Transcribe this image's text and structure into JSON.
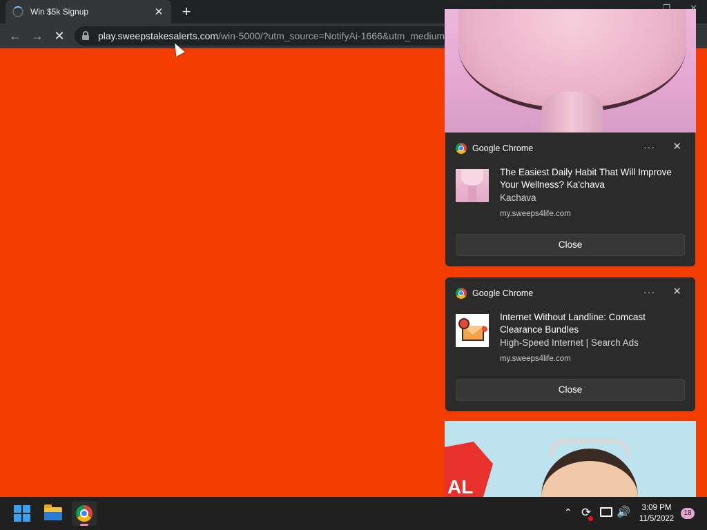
{
  "browser": {
    "tab": {
      "title": "Win $5k Signup",
      "close_glyph": "✕"
    },
    "new_tab_glyph": "+",
    "nav": {
      "back_glyph": "←",
      "forward_glyph": "→",
      "stop_glyph": "✕"
    },
    "address": {
      "host": "play.sweepstakesalerts.com",
      "path": "/win-5000/?utm_source=NotifyAi-1666&utm_medium"
    },
    "window_controls": {
      "restore_glyph": "❐",
      "close_glyph": "✕"
    }
  },
  "page": {
    "background_color": "#f33d00"
  },
  "notifications": [
    {
      "app": "Google Chrome",
      "more_glyph": "···",
      "close_glyph": "✕",
      "title": "The Easiest Daily Habit That Will Improve Your Wellness? Ka'chava",
      "body": "Kachava",
      "source": "my.sweeps4life.com",
      "button": "Close",
      "thumb": "smoothie-cup-image"
    },
    {
      "app": "Google Chrome",
      "more_glyph": "···",
      "close_glyph": "✕",
      "title": "Internet Without Landline: Comcast Clearance Bundles",
      "body": "High-Speed Internet | Search Ads",
      "source": "my.sweeps4life.com",
      "button": "Close",
      "thumb": "mail-alert-icon"
    }
  ],
  "ad_partial_text": "AL",
  "taskbar": {
    "chevron_glyph": "⌃",
    "sync_glyph": "⟳",
    "volume_glyph": "🔊",
    "time": "3:09 PM",
    "date": "11/5/2022",
    "notification_count": "18"
  }
}
